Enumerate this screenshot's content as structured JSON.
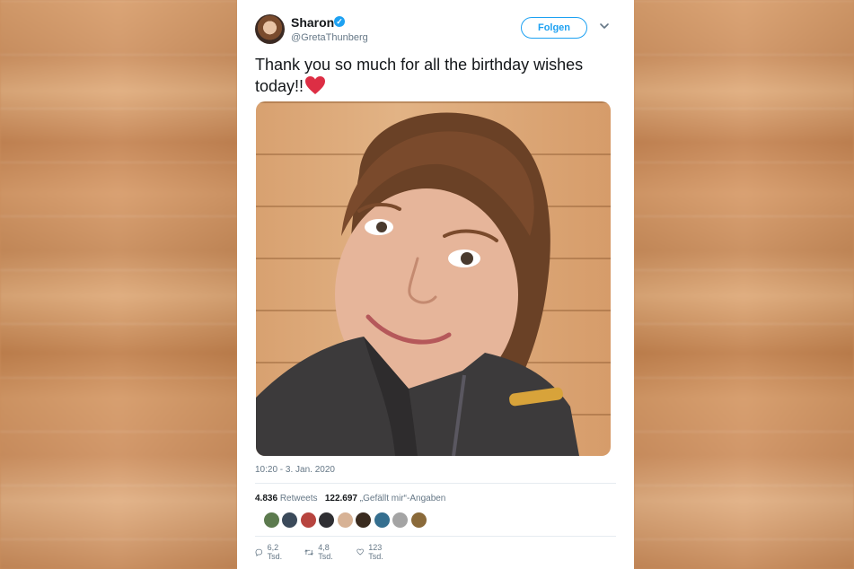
{
  "tweet": {
    "display_name": "Sharon",
    "handle": "@GretaThunberg",
    "follow_label": "Folgen",
    "text": "Thank you so much for all the birthday wishes today!!",
    "timestamp": "10:20 - 3. Jan. 2020",
    "retweets_count": "4.836",
    "retweets_label": "Retweets",
    "likes_count": "122.697",
    "likes_label": "„Gefällt mir“-Angaben",
    "replies_short": "6,2 Tsd.",
    "retweets_short": "4,8 Tsd.",
    "likes_short": "123 Tsd."
  },
  "icons": {
    "verified": "verified-badge-icon",
    "menu": "chevron-down-icon",
    "emoji": "red-heart-emoji",
    "reply": "reply-icon",
    "retweet": "retweet-icon",
    "like": "heart-icon"
  },
  "colors": {
    "accent": "#1da1f2",
    "text": "#14171a",
    "muted": "#657786",
    "heart": "#e0245e"
  }
}
